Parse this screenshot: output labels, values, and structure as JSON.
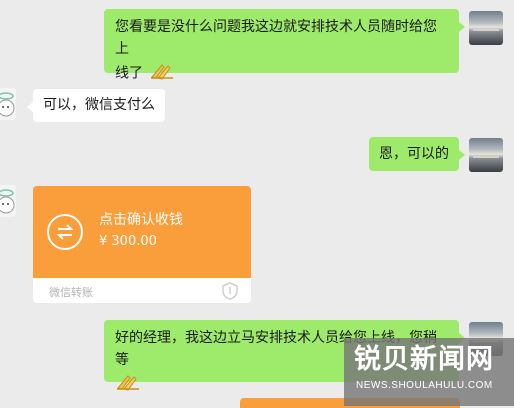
{
  "messages": [
    {
      "from": "self",
      "text": "您看要是没什么问题我这边就安排技术人员随时给您上",
      "text2": "线了",
      "emoji": "prayer-hands"
    },
    {
      "from": "other",
      "text": "可以，微信支付么"
    },
    {
      "from": "self",
      "text": "恩，可以的"
    },
    {
      "from": "self",
      "text": "好的经理，我这边立马安排技术人员给您上线，您稍等",
      "emoji": "prayer-hands"
    }
  ],
  "transfer": {
    "title": "点击确认收钱",
    "amount": "¥ 300.00",
    "footer": "微信转账",
    "icon": "transfer-arrows-icon"
  },
  "watermark": {
    "brand": "锐贝新闻网",
    "url": "NEWS.SHOULAHULU.COM"
  },
  "colors": {
    "self_bubble": "#9eea6a",
    "other_bubble": "#ffffff",
    "transfer_orange": "#fa9d3b",
    "chat_background": "#ebebeb"
  }
}
